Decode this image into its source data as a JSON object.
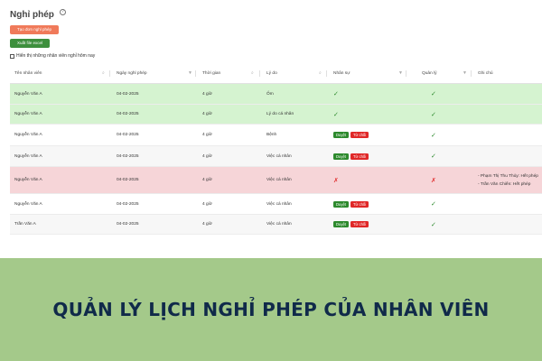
{
  "page": {
    "title": "Nghỉ phép",
    "help_icon": "question-circle-icon"
  },
  "buttons": {
    "create": "Tạo đơn nghỉ phép",
    "excel": "Xuất file excel"
  },
  "filter": {
    "label": "Hiển thị những nhân viên nghỉ hôm nay",
    "checked": false
  },
  "table": {
    "columns": [
      "Tên nhân viên",
      "Ngày nghỉ phép",
      "Thời gian",
      "Lý do",
      "Nhân sự",
      "Quản lý",
      "Ghi chú"
    ],
    "actions": {
      "approve": "Duyệt",
      "reject": "Từ chối"
    },
    "rows": [
      {
        "name": "Nguyễn Văn A",
        "date": "04-02-2025",
        "time": "4 giờ",
        "reason": "Ốm",
        "hr": "approved",
        "manager": "approved",
        "status": "approved",
        "notes": []
      },
      {
        "name": "Nguyễn Văn A",
        "date": "04-02-2025",
        "time": "4 giờ",
        "reason": "Lý do cá nhân",
        "hr": "approved",
        "manager": "approved",
        "status": "approved",
        "notes": []
      },
      {
        "name": "Nguyễn Văn A",
        "date": "04-02-2025",
        "time": "4 giờ",
        "reason": "Bệnh",
        "hr": "pending",
        "manager": "approved",
        "status": "pending",
        "notes": []
      },
      {
        "name": "Nguyễn Văn A",
        "date": "04-02-2025",
        "time": "4 giờ",
        "reason": "Việc cá nhân",
        "hr": "pending",
        "manager": "approved",
        "status": "pending",
        "notes": []
      },
      {
        "name": "Nguyễn Văn A",
        "date": "04-02-2025",
        "time": "4 giờ",
        "reason": "Việc cá nhân",
        "hr": "rejected",
        "manager": "rejected",
        "status": "rejected",
        "notes": [
          "- Phạm Thị Thu Thủy: Hết phép",
          "- Trần Văn Chiến: Hết phép"
        ]
      },
      {
        "name": "Nguyễn Văn A",
        "date": "04-02-2025",
        "time": "4 giờ",
        "reason": "Việc cá nhân",
        "hr": "pending",
        "manager": "approved",
        "status": "pending",
        "notes": []
      },
      {
        "name": "Trần Văn A",
        "date": "04-02-2025",
        "time": "4 giờ",
        "reason": "Việc cá nhân",
        "hr": "pending",
        "manager": "approved",
        "status": "pending",
        "notes": []
      }
    ]
  },
  "banner": {
    "text": "QUẢN LÝ LỊCH NGHỈ PHÉP CỦA NHÂN VIÊN"
  },
  "colors": {
    "approved_row": "#d5f3d0",
    "rejected_row": "#f6d5d8",
    "approve_badge": "#2d8a2d",
    "reject_badge": "#e02828",
    "create_button": "#f07a5a",
    "excel_button": "#3d8f3d",
    "banner_bg": "#a4c98a",
    "banner_text": "#102a4a"
  }
}
